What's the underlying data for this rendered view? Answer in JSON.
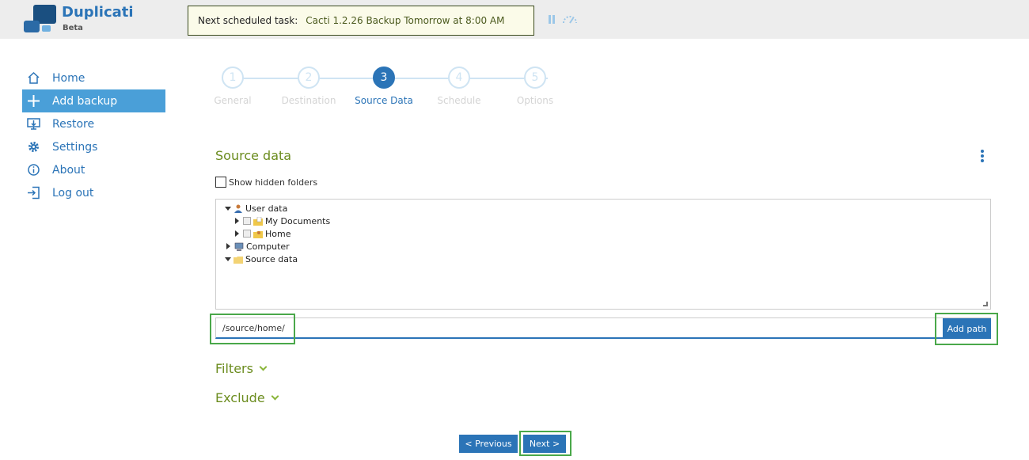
{
  "header": {
    "brand": "Duplicati",
    "subtitle": "Beta",
    "scheduled_label": "Next scheduled task:",
    "scheduled_value": "Cacti 1.2.26 Backup Tomorrow at 8:00 AM"
  },
  "sidebar": {
    "items": [
      {
        "label": "Home",
        "icon": "home-icon"
      },
      {
        "label": "Add backup",
        "icon": "plus-icon"
      },
      {
        "label": "Restore",
        "icon": "restore-icon"
      },
      {
        "label": "Settings",
        "icon": "gear-icon"
      },
      {
        "label": "About",
        "icon": "info-icon"
      },
      {
        "label": "Log out",
        "icon": "logout-icon"
      }
    ],
    "active": "Add backup"
  },
  "steps": [
    {
      "number": "1",
      "label": "General"
    },
    {
      "number": "2",
      "label": "Destination"
    },
    {
      "number": "3",
      "label": "Source Data"
    },
    {
      "number": "4",
      "label": "Schedule"
    },
    {
      "number": "5",
      "label": "Options"
    }
  ],
  "current_step": "3",
  "source": {
    "title": "Source data",
    "show_hidden_label": "Show hidden folders",
    "tree": [
      {
        "label": "User data",
        "icon": "user-icon"
      },
      {
        "label": "My Documents",
        "icon": "documents-folder-icon"
      },
      {
        "label": "Home",
        "icon": "home-folder-icon"
      },
      {
        "label": "Computer",
        "icon": "computer-icon"
      },
      {
        "label": "Source data",
        "icon": "folder-icon"
      }
    ],
    "path_value": "/source/home/",
    "add_path_label": "Add path",
    "filters_label": "Filters",
    "exclude_label": "Exclude"
  },
  "nav": {
    "previous_label": "< Previous",
    "next_label": "Next >"
  },
  "colors": {
    "accent": "#2b74b7",
    "sidebar_active": "#4a9fd8",
    "section_green": "#6b8c1e",
    "highlight": "#4aa84a"
  }
}
